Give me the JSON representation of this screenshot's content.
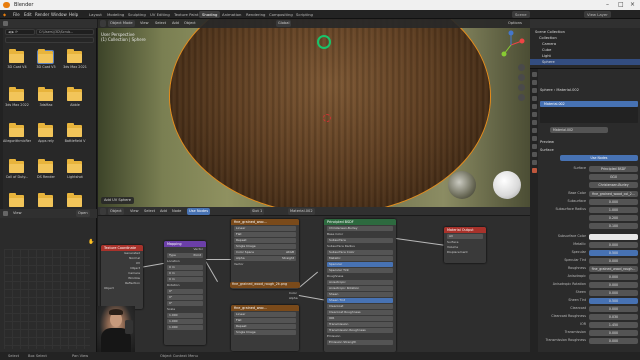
{
  "titlebar": {
    "app_title": "Blender"
  },
  "menu": {
    "items": [
      "File",
      "Edit",
      "Render",
      "Window",
      "Help"
    ],
    "workspaces": [
      "Layout",
      "Modeling",
      "Sculpting",
      "UV Editing",
      "Texture Paint",
      "Shading",
      "Animation",
      "Rendering",
      "Compositing",
      "Scripting"
    ],
    "active_workspace": "Shading",
    "scene": "Scene",
    "view_layer": "View Layer"
  },
  "file_browser": {
    "path": "C:\\Users\\\\3D\\Scrub...",
    "folders": [
      "3D Coat V4",
      "3D Coat V5",
      "3ds Max 2021",
      "3ds Max 2022",
      "3dsMax",
      "Abble",
      "AllegorithmicRender",
      "Apps rely",
      "Battlefield V",
      "Call of Duty...",
      "DS Render",
      "Lightshot"
    ],
    "selected_folder": "3D Coat V5"
  },
  "preview": {
    "header_left": "View",
    "header_right": "Open"
  },
  "viewport": {
    "mode": "Object Mode",
    "menus": [
      "View",
      "Select",
      "Add",
      "Object"
    ],
    "info_line1": "User Perspective",
    "info_line2": "(1) Collection | Sphere",
    "last_op": "Add UV Sphere",
    "transform": "Global",
    "options": "Options"
  },
  "node_editor": {
    "mode": "Object",
    "menus": [
      "View",
      "Select",
      "Add",
      "Node"
    ],
    "use_nodes": "Use Nodes",
    "slot": "Slot 1",
    "material": "Material.002",
    "nodes": {
      "texcoord": {
        "title": "Texture Coordinate",
        "outputs": [
          "Generated",
          "Normal",
          "UV",
          "Object",
          "Camera",
          "Window",
          "Reflection"
        ],
        "object_label": "Object"
      },
      "mapping": {
        "title": "Mapping",
        "out": "Vector",
        "type_label": "Type",
        "type": "Point",
        "loc_label": "Location",
        "rot_label": "Rotation",
        "scale_label": "Scale",
        "loc": [
          "0 m",
          "0 m",
          "0 m"
        ],
        "rot": [
          "0°",
          "0°",
          "0°"
        ],
        "scale": [
          "1.000",
          "1.000",
          "1.000"
        ]
      },
      "tex1": {
        "title": "fine_grained_woo...",
        "rows": [
          "Linear",
          "Flat",
          "Repeat",
          "Single Image"
        ],
        "color_space_label": "Color Space",
        "color_space": "sRGB",
        "alpha_label": "Alpha",
        "alpha": "Straight",
        "vector": "Vector"
      },
      "tex2": {
        "title": "fine_grained_woo...",
        "rows": [
          "Linear",
          "Flat",
          "Repeat",
          "Single Image"
        ]
      },
      "file_bar": "fine_grained_wood_rough_2k.png",
      "bsdf": {
        "title": "Principled BSDF",
        "dist": "Christensen-Burley",
        "rows": [
          "Base Color",
          "Subsurface",
          "Subsurface Radius",
          "Subsurface Color",
          "Metallic",
          "Specular",
          "Specular Tint",
          "Roughness",
          "Anisotropic",
          "Anisotropic Rotation",
          "Sheen",
          "Sheen Tint",
          "Clearcoat",
          "Clearcoat Roughness",
          "IOR",
          "Transmission",
          "Transmission Roughness",
          "Emission",
          "Emission Strength"
        ]
      },
      "output": {
        "title": "Material Output",
        "target": "All",
        "rows": [
          "Surface",
          "Volume",
          "Displacement"
        ]
      }
    },
    "sockets": [
      "Color",
      "Alpha"
    ]
  },
  "outliner": {
    "title": "Scene Collection",
    "items": [
      "Collection",
      "Camera",
      "Cube",
      "Light",
      "Sphere"
    ],
    "selected": "Sphere"
  },
  "properties": {
    "object": "Sphere",
    "material": "Material.002",
    "slot": "Material.002",
    "preview_label": "Preview",
    "surface_label": "Surface",
    "use_nodes": "Use Nodes",
    "surface_row": {
      "label": "Surface",
      "value": "Principled BSDF"
    },
    "dist_rows": [
      "GGX",
      "Christensen-Burley"
    ],
    "rows": [
      {
        "label": "Base Color",
        "value": "fine_grained_wood_col_2..."
      },
      {
        "label": "Subsurface",
        "value": "0.000"
      },
      {
        "label": "Subsurface Radius",
        "value": "1.000"
      },
      {
        "label": "",
        "value": "0.200"
      },
      {
        "label": "",
        "value": "0.100"
      },
      {
        "label": "Subsurface Color",
        "value": ""
      },
      {
        "label": "Metallic",
        "value": "0.000"
      },
      {
        "label": "Specular",
        "value": "0.500"
      },
      {
        "label": "Specular Tint",
        "value": "0.000"
      },
      {
        "label": "Roughness",
        "value": "fine_grained_wood_rough..."
      },
      {
        "label": "Anisotropic",
        "value": "0.000"
      },
      {
        "label": "Anisotropic Rotation",
        "value": "0.000"
      },
      {
        "label": "Sheen",
        "value": "0.000"
      },
      {
        "label": "Sheen Tint",
        "value": "0.500"
      },
      {
        "label": "Clearcoat",
        "value": "0.000"
      },
      {
        "label": "Clearcoat Roughness",
        "value": "0.030"
      },
      {
        "label": "IOR",
        "value": "1.450"
      },
      {
        "label": "Transmission",
        "value": "0.000"
      },
      {
        "label": "Transmission Roughness",
        "value": "0.000"
      }
    ]
  },
  "statusbar": {
    "left": "Select",
    "mid1": "Box Select",
    "mid2": "Object Context Menu",
    "right": "Pan View"
  },
  "colors": {
    "accent": "#4772b3",
    "selection_outline": "#e88b18",
    "folder": "#e8b43c",
    "cursor": "#19c46a"
  }
}
